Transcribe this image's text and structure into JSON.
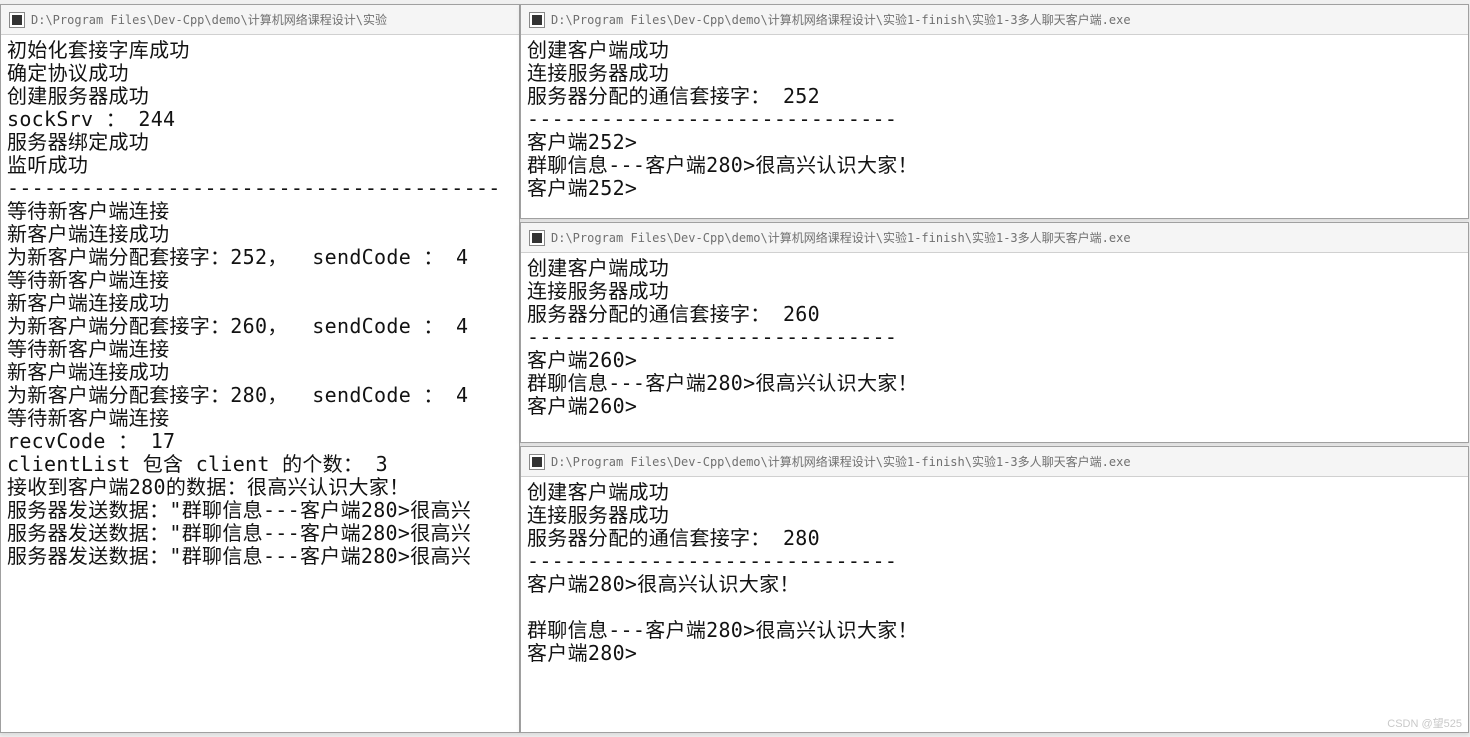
{
  "watermark": "CSDN @望525",
  "windows": {
    "server": {
      "title": "D:\\Program Files\\Dev-Cpp\\demo\\计算机网络课程设计\\实验",
      "lines": [
        "初始化套接字库成功",
        "确定协议成功",
        "创建服务器成功",
        "sockSrv ： 244",
        "服务器绑定成功",
        "监听成功",
        "----------------------------------------",
        "等待新客户端连接",
        "新客户端连接成功",
        "为新客户端分配套接字：252，  sendCode ： 4",
        "等待新客户端连接",
        "新客户端连接成功",
        "为新客户端分配套接字：260，  sendCode ： 4",
        "等待新客户端连接",
        "新客户端连接成功",
        "为新客户端分配套接字：280，  sendCode ： 4",
        "等待新客户端连接",
        "recvCode ： 17",
        "clientList 包含 client 的个数： 3",
        "接收到客户端280的数据：很高兴认识大家！",
        "服务器发送数据：\"群聊信息---客户端280>很高兴",
        "服务器发送数据：\"群聊信息---客户端280>很高兴",
        "服务器发送数据：\"群聊信息---客户端280>很高兴"
      ]
    },
    "client1": {
      "title": "D:\\Program Files\\Dev-Cpp\\demo\\计算机网络课程设计\\实验1-finish\\实验1-3多人聊天客户端.exe",
      "lines": [
        "创建客户端成功",
        "连接服务器成功",
        "服务器分配的通信套接字： 252",
        "------------------------------",
        "客户端252>",
        "群聊信息---客户端280>很高兴认识大家！",
        "客户端252>"
      ]
    },
    "client2": {
      "title": "D:\\Program Files\\Dev-Cpp\\demo\\计算机网络课程设计\\实验1-finish\\实验1-3多人聊天客户端.exe",
      "lines": [
        "创建客户端成功",
        "连接服务器成功",
        "服务器分配的通信套接字： 260",
        "------------------------------",
        "客户端260>",
        "群聊信息---客户端280>很高兴认识大家！",
        "客户端260>"
      ]
    },
    "client3": {
      "title": "D:\\Program Files\\Dev-Cpp\\demo\\计算机网络课程设计\\实验1-finish\\实验1-3多人聊天客户端.exe",
      "lines": [
        "创建客户端成功",
        "连接服务器成功",
        "服务器分配的通信套接字： 280",
        "------------------------------",
        "客户端280>很高兴认识大家！",
        "",
        "群聊信息---客户端280>很高兴认识大家！",
        "客户端280>"
      ]
    }
  }
}
